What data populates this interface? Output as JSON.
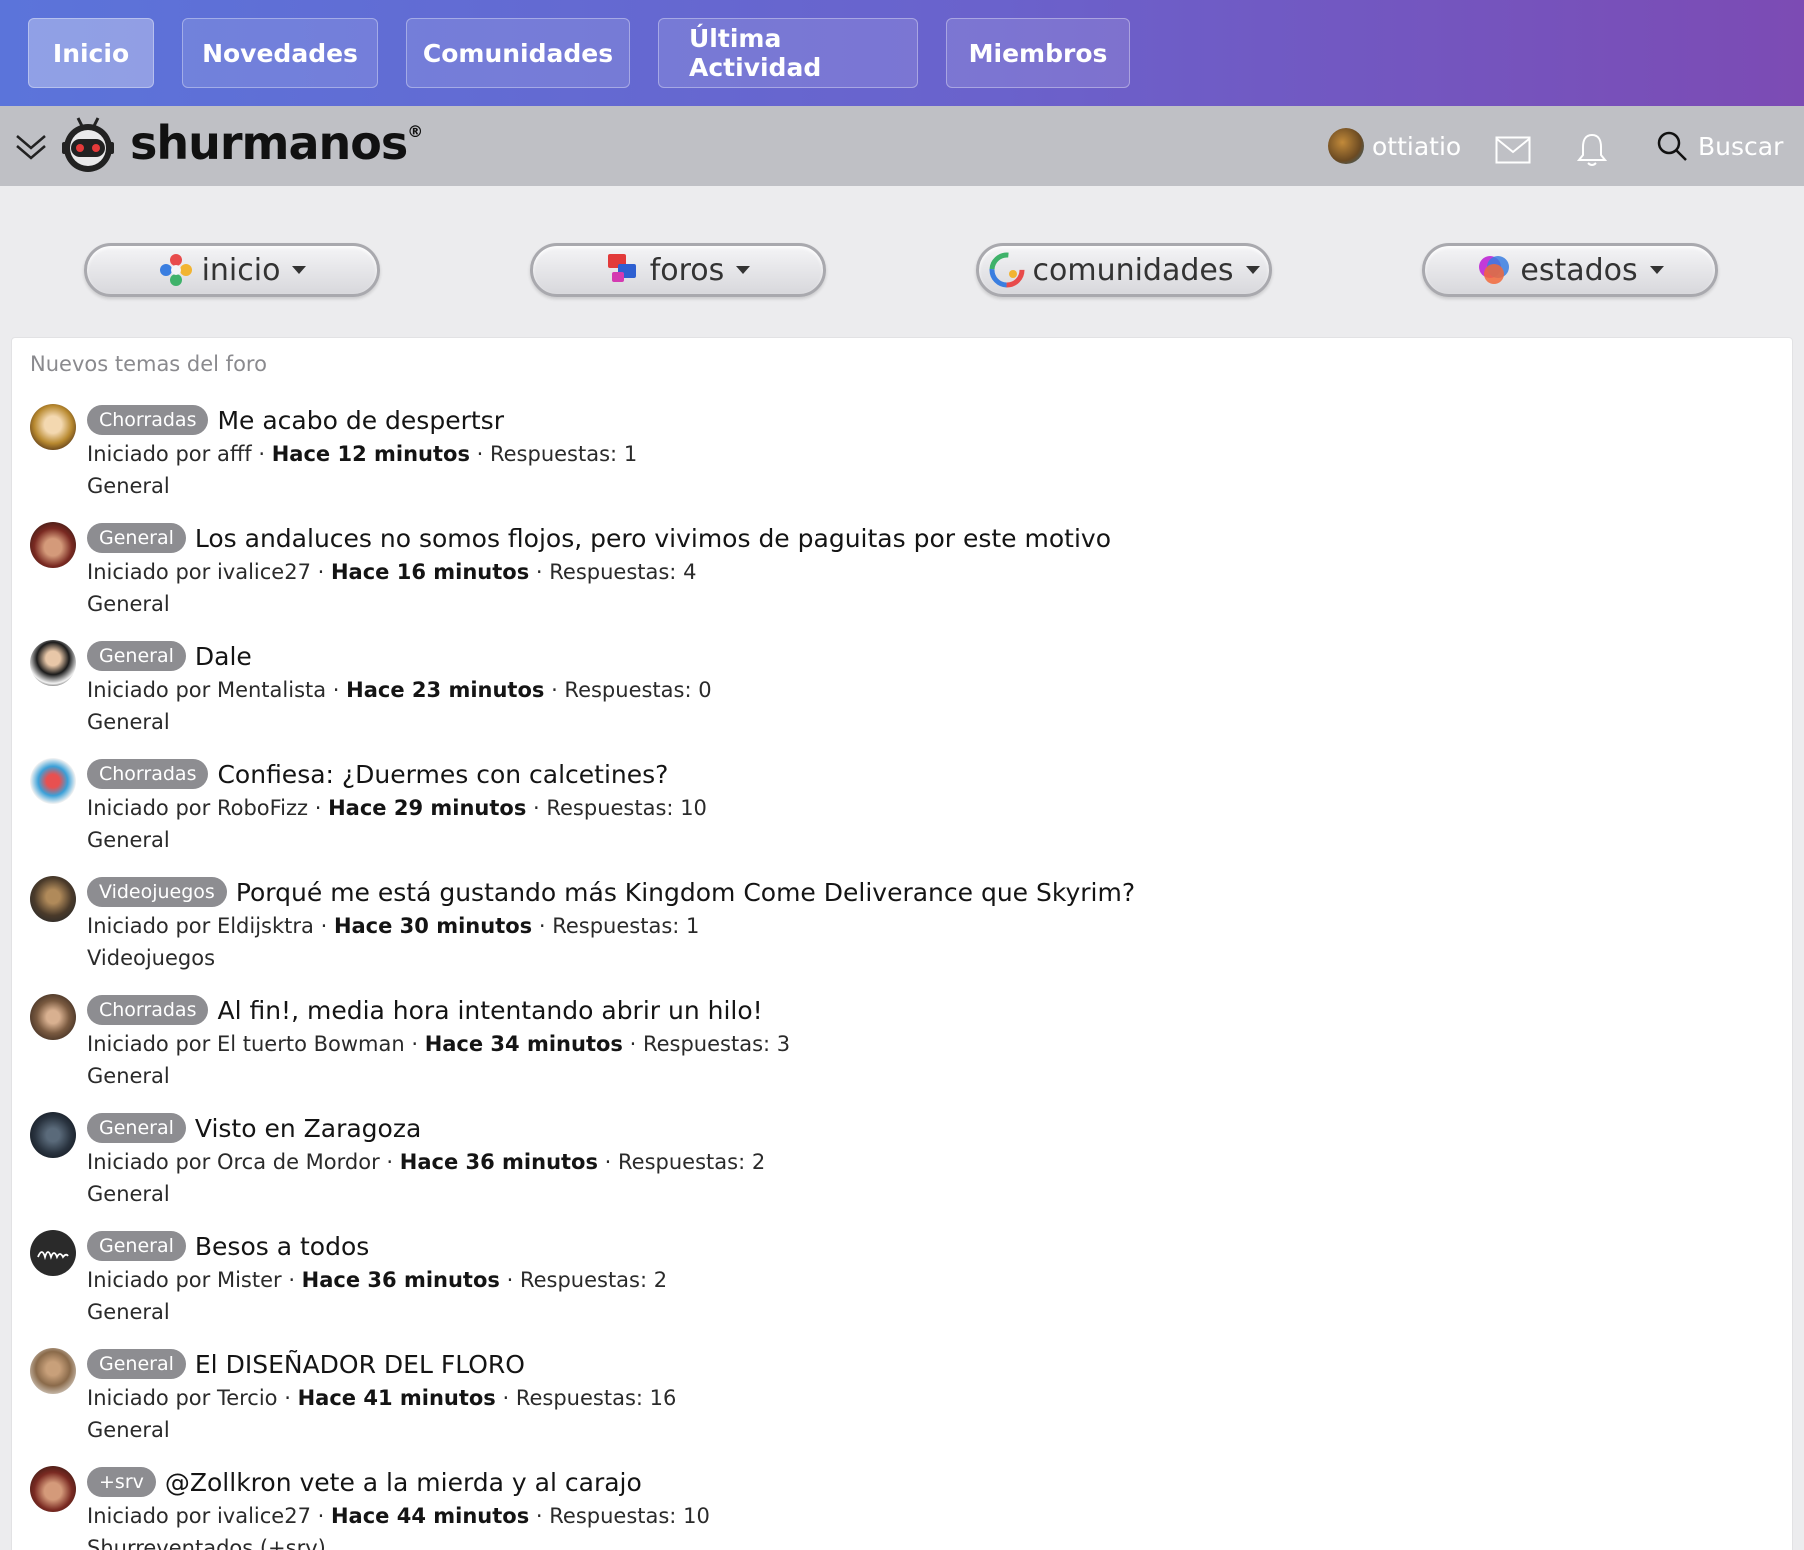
{
  "topnav": {
    "items": [
      "Inicio",
      "Novedades",
      "Comunidades",
      "Última Actividad",
      "Miembros"
    ]
  },
  "header": {
    "logo": "shurmanos",
    "logo_mark": "®",
    "username": "ottiatio",
    "search_label": "Buscar"
  },
  "pills": [
    {
      "label": "inicio",
      "icon": "inicio-icon"
    },
    {
      "label": "foros",
      "icon": "foros-icon"
    },
    {
      "label": "comunidades",
      "icon": "comunidades-icon"
    },
    {
      "label": "estados",
      "icon": "estados-icon"
    }
  ],
  "card": {
    "title": "Nuevos temas del foro",
    "prefix": "Iniciado por",
    "replies_label": "Respuestas:",
    "items": [
      {
        "tag": "Chorradas",
        "title": "Me acabo de despertsr",
        "author": "afff",
        "time": "Hace 12 minutos",
        "replies": "1",
        "forum": "General"
      },
      {
        "tag": "General",
        "title": "Los andaluces no somos flojos, pero vivimos de paguitas por este motivo",
        "author": "ivalice27",
        "time": "Hace 16 minutos",
        "replies": "4",
        "forum": "General"
      },
      {
        "tag": "General",
        "title": "Dale",
        "author": "Mentalista",
        "time": "Hace 23 minutos",
        "replies": "0",
        "forum": "General"
      },
      {
        "tag": "Chorradas",
        "title": "Confiesa: ¿Duermes con calcetines?",
        "author": "RoboFizz",
        "time": "Hace 29 minutos",
        "replies": "10",
        "forum": "General"
      },
      {
        "tag": "Videojuegos",
        "title": "Porqué me está gustando más Kingdom Come Deliverance que Skyrim?",
        "author": "Eldijsktra",
        "time": "Hace 30 minutos",
        "replies": "1",
        "forum": "Videojuegos"
      },
      {
        "tag": "Chorradas",
        "title": "Al fin!, media hora intentando abrir un hilo!",
        "author": "El tuerto Bowman",
        "time": "Hace 34 minutos",
        "replies": "3",
        "forum": "General"
      },
      {
        "tag": "General",
        "title": "Visto en Zaragoza",
        "author": "Orca de Mordor",
        "time": "Hace 36 minutos",
        "replies": "2",
        "forum": "General"
      },
      {
        "tag": "General",
        "title": "Besos a todos",
        "author": "Mister",
        "time": "Hace 36 minutos",
        "replies": "2",
        "forum": "General"
      },
      {
        "tag": "General",
        "title": "El DISEÑADOR DEL FLORO",
        "author": "Tercio",
        "time": "Hace 41 minutos",
        "replies": "16",
        "forum": "General"
      },
      {
        "tag": "+srv",
        "title": "@Zollkron vete a la mierda y al carajo",
        "author": "ivalice27",
        "time": "Hace 44 minutos",
        "replies": "10",
        "forum": "Shurreventados (+srv)"
      }
    ]
  },
  "colors": {
    "nav_gradient_start": "#5b74da",
    "nav_gradient_end": "#7c4bb4",
    "header_bg": "#bfc0c5",
    "tag_bg": "#8d8d91"
  }
}
